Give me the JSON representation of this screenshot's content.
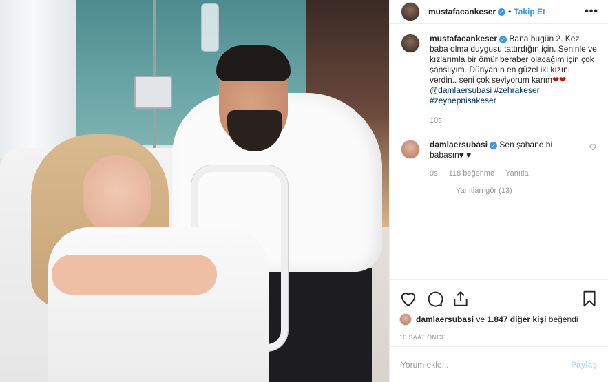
{
  "post": {
    "author": "mustafacankeser",
    "follow_label": "Takip Et",
    "separator": "•",
    "more_label": "•••",
    "verified_mark": "✓"
  },
  "caption": {
    "author": "mustafacankeser",
    "text": " Bana bugün 2. Kez baba olma duygusu tattırdığın için. Seninle ve kızlarımla bir ömür beraber olacağım için çok şanslıyım. Dünyanın en güzel iki kızını verdin.. seni çok seviyorum karım",
    "hearts": "❤❤",
    "tags": [
      "@damlaersubasi",
      "#zehrakeser",
      "#zeynepnisakeser"
    ],
    "time": "10s"
  },
  "reply": {
    "author": "damlaersubasi",
    "text": " Sen şahane bi babasın",
    "hearts": "♥ ♥",
    "time": "9s",
    "likes": "118 beğenme",
    "reply_label": "Yanıtla",
    "view_replies": "Yanıtları gör (13)"
  },
  "actions": {
    "liked_by_user": "damlaersubasi",
    "liked_by_rest": " ve ",
    "liked_by_count": "1.847 diğer kişi",
    "liked_by_suffix": " beğendi",
    "timestamp": "10 SAAT ÖNCE"
  },
  "comment_box": {
    "placeholder": "Yorum ekle...",
    "submit_label": "Paylaş"
  },
  "icons": [
    "heart-icon",
    "comment-icon",
    "share-icon",
    "bookmark-icon"
  ],
  "colors": {
    "link": "#3897f0",
    "tag": "#003569",
    "muted": "#999999",
    "heart_red": "#c21807"
  }
}
